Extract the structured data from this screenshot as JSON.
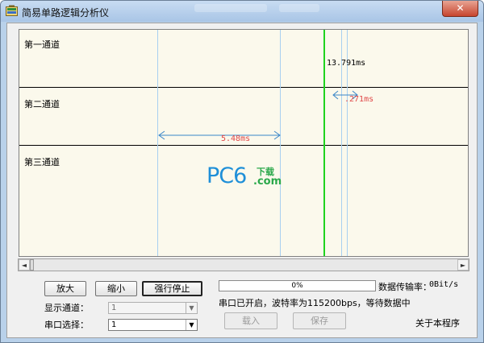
{
  "window": {
    "title": "简易单路逻辑分析仪",
    "close_symbol": "✕"
  },
  "plot": {
    "channels": [
      "第一通道",
      "第二通道",
      "第三通道"
    ],
    "measurements": {
      "green_to_cursor": "13.791ms",
      "small_span": ".271ms",
      "wide_span": "5.48ms"
    },
    "colors": {
      "background": "#fbf9ec",
      "cursor_lines": "#a8d0f0",
      "marker_line": "#1fd31f",
      "measure_arrow": "#3a86c8",
      "measure_text_red": "#e04848"
    }
  },
  "watermark": {
    "main": "PC6",
    "sub_top": "下载",
    "sub_bottom": ".com"
  },
  "scrollbar": {
    "left_arrow": "◄",
    "right_arrow": "►"
  },
  "controls": {
    "zoom_in_label": "放大",
    "zoom_out_label": "缩小",
    "force_stop_label": "强行停止",
    "display_channel_label": "显示通道：",
    "display_channel_value": "1",
    "serial_select_label": "串口选择：",
    "serial_select_value": "1",
    "load_label": "载入",
    "save_label": "保存",
    "about_label": "关于本程序"
  },
  "status": {
    "progress_text": "0%",
    "progress_value": 0,
    "transfer_rate_label": "数据传输率：",
    "transfer_rate_value": "0Bit/s",
    "serial_status": "串口已开启，波特率为115200bps，等待数据中"
  }
}
